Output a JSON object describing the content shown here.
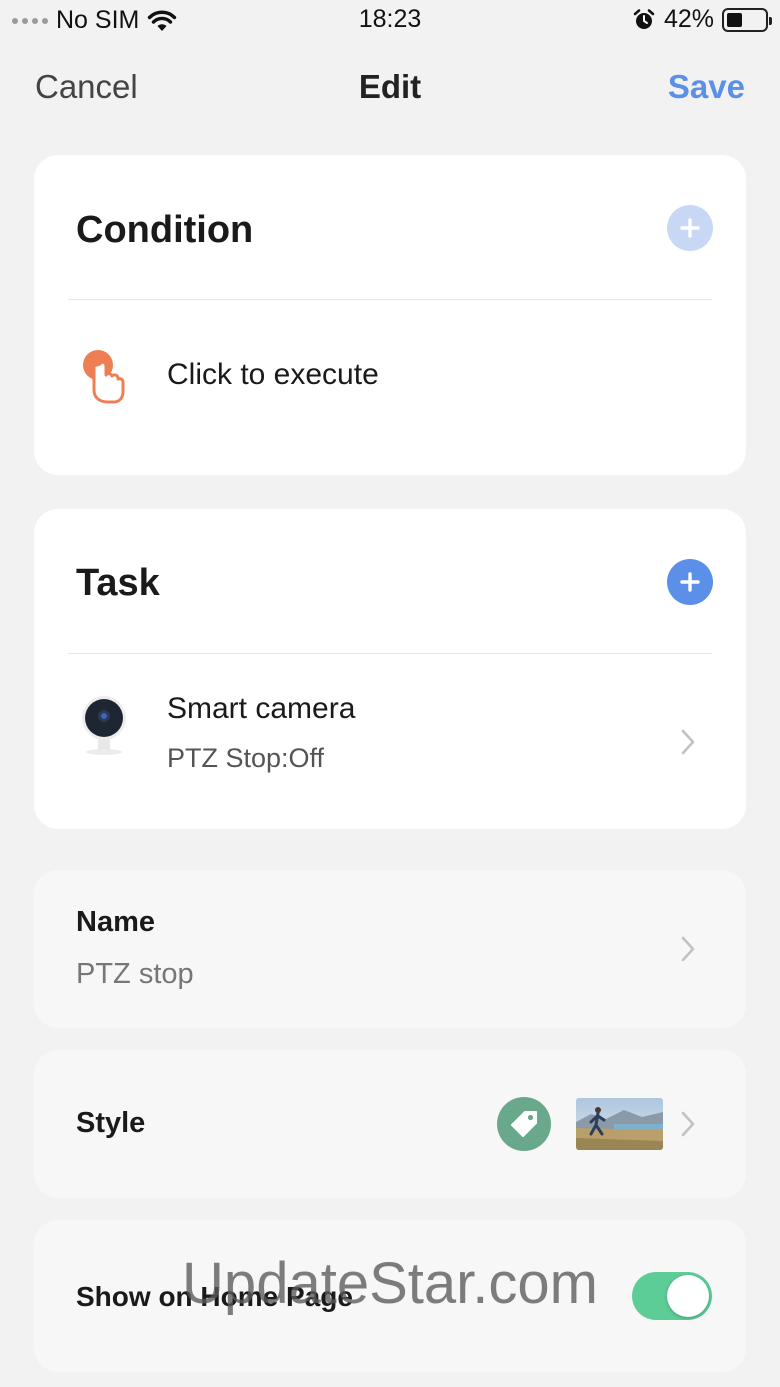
{
  "status_bar": {
    "carrier": "No SIM",
    "time": "18:23",
    "battery_percent": "42%",
    "battery_level": 0.42
  },
  "nav": {
    "cancel_label": "Cancel",
    "title": "Edit",
    "save_label": "Save"
  },
  "condition": {
    "title": "Condition",
    "item_label": "Click to execute",
    "item_icon": "tap-hand-icon",
    "add_icon": "plus-icon"
  },
  "task": {
    "title": "Task",
    "device_name": "Smart camera",
    "device_action": "PTZ Stop:Off",
    "device_icon": "camera-icon",
    "add_icon": "plus-icon"
  },
  "name_row": {
    "label": "Name",
    "value": "PTZ stop"
  },
  "style_row": {
    "label": "Style",
    "icon": "tag-icon",
    "icon_color": "#6aa88c"
  },
  "home_row": {
    "label": "Show on Home Page",
    "enabled": true
  },
  "watermark": "UpdateStar.com",
  "colors": {
    "accent": "#5b8fe8",
    "add_disabled": "#c7d7f4",
    "toggle_on": "#5ccd97",
    "tap_icon": "#ee7f55"
  }
}
